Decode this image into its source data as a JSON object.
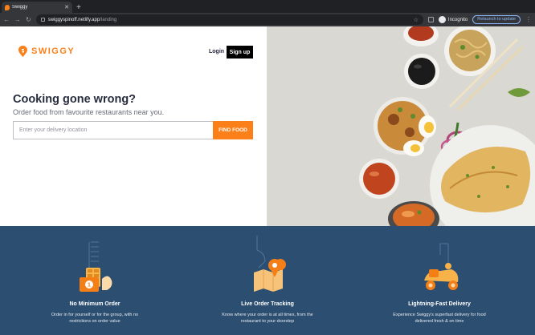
{
  "browser": {
    "tab_title": "Swiggy",
    "url_host": "swiggyspinoff.netlify.app",
    "url_path": "/landing",
    "profile": "Incognito",
    "relaunch_label": "Relaunch to update"
  },
  "header": {
    "logo_text": "SWIGGY",
    "login_label": "Login",
    "signup_label": "Sign up"
  },
  "hero": {
    "headline": "Cooking gone wrong?",
    "subline": "Order food from favourite restaurants near you.",
    "search_placeholder": "Enter your delivery location",
    "find_label": "FIND FOOD"
  },
  "features": [
    {
      "title": "No Minimum Order",
      "desc": "Order in for yourself or for the group, with no restrictions on order value"
    },
    {
      "title": "Live Order Tracking",
      "desc": "Know where your order is at all times, from the restaurant to your doorstep"
    },
    {
      "title": "Lightning-Fast Delivery",
      "desc": "Experience Swiggy's superfast delivery for food delivered fresh & on time"
    }
  ],
  "colors": {
    "brand": "#fc8019",
    "features_bg": "#2b4e71",
    "signup_bg": "#000000"
  }
}
